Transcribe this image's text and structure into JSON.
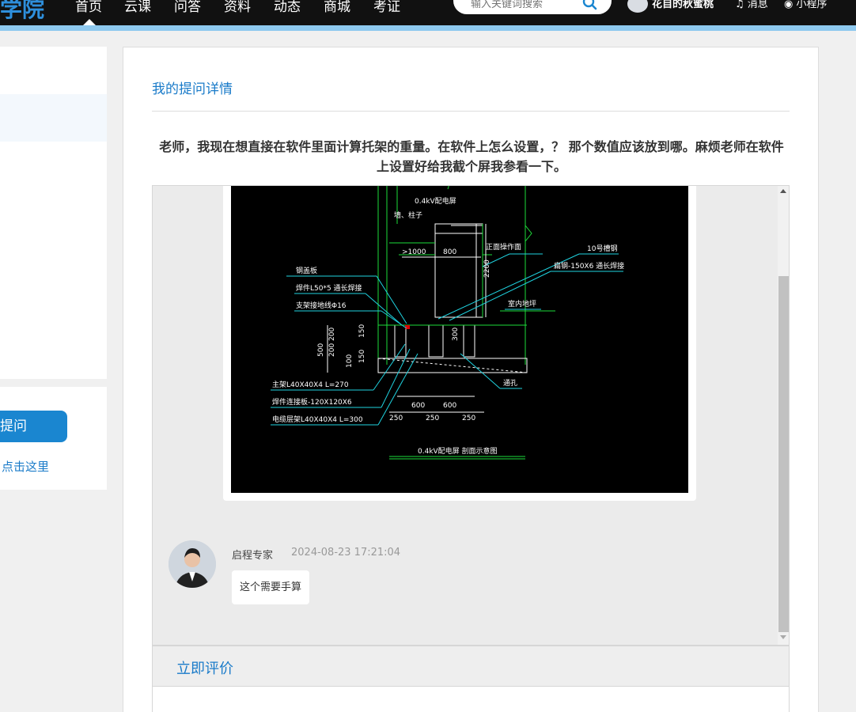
{
  "nav": {
    "logo": "学院",
    "items": [
      "首页",
      "云课",
      "问答",
      "资料",
      "动态",
      "商城",
      "考证"
    ],
    "active": "首页",
    "search_placeholder": "输入关键词搜索",
    "user_name": "花自的秋蜜桃",
    "messages": "消息",
    "mini_program": "小程序"
  },
  "sidebar": {
    "ask_button": "提问",
    "click_here": "点击这里"
  },
  "question_detail": {
    "title": "我的提问详情",
    "question": "老师，我现在想直接在软件里面计算托架的重量。在软件上怎么设置，？ 那个数值应该放到哪。麻烦老师在软件上设置好给我截个屏我参看一下。"
  },
  "drawing": {
    "labels": {
      "panel": "0.4kV配电屏",
      "wall": "墙、柱子",
      "gt1000": ">1000",
      "w800": "800",
      "op_face": "正面操作面",
      "channel": "10号槽钢",
      "flat_steel": "扁钢-150X6 通长焊接",
      "h2200": "2200",
      "steel_cover": "钢盖板",
      "angle_steel": "焊件L50*5 通长焊接",
      "ground": "支架接地线Φ16",
      "indoor": "室内地坪",
      "d500": "500",
      "d200": "200",
      "d150": "150",
      "d300": "300",
      "d200b": "200",
      "d100": "100",
      "d150b": "150",
      "main_frame": "主架L40X40X4 L=270",
      "plate": "焊件连接板-120X120X6",
      "cable_frame": "电缆层架L40X40X4 L=300",
      "hole": "通孔",
      "d600a": "600",
      "d600b": "600",
      "d250a": "250",
      "d250b": "250",
      "d250c": "250",
      "caption": "0.4kV配电屏  剖面示意图"
    }
  },
  "reply": {
    "author": "启程专家",
    "time": "2024-08-23 17:21:04",
    "text": "这个需要手算"
  },
  "rating": {
    "label": "立即评价"
  }
}
